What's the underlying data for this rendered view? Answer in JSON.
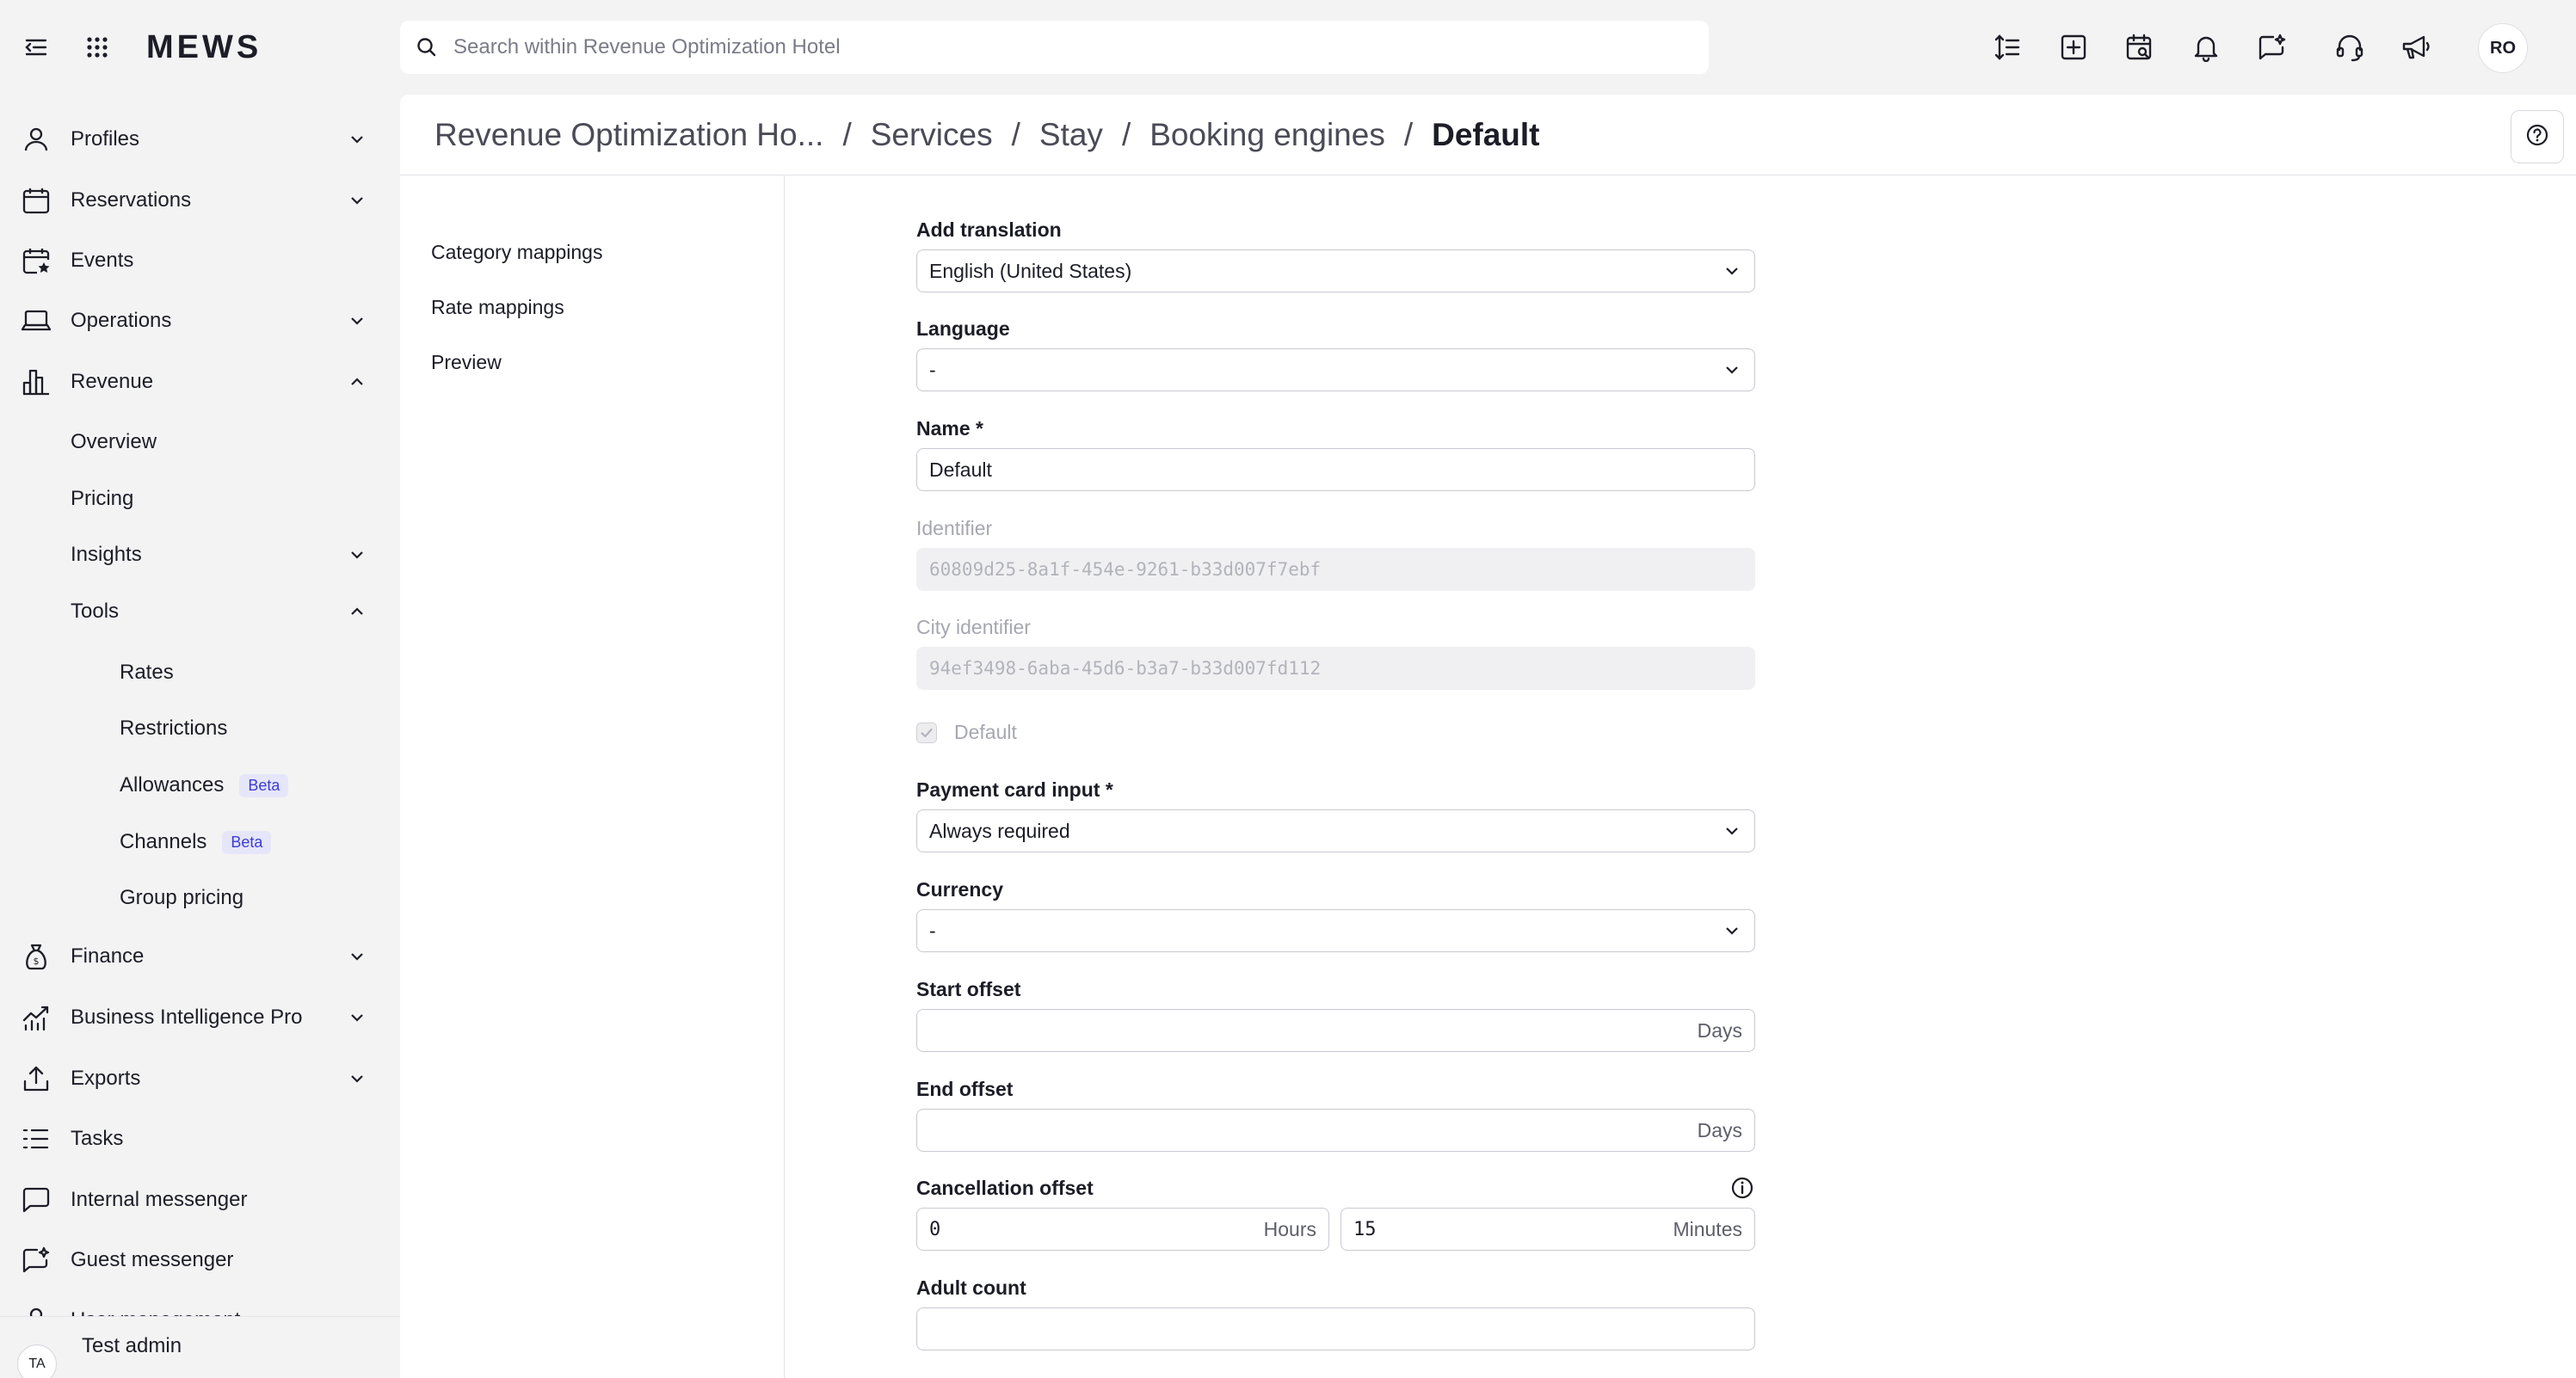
{
  "app": {
    "logo_text": "MEWS"
  },
  "search": {
    "placeholder": "Search within Revenue Optimization Hotel"
  },
  "topbar": {
    "icons": [
      "text-height-icon",
      "add-square-icon",
      "calendar-search-icon",
      "bell-icon",
      "chat-sparkle-icon",
      "headset-icon",
      "megaphone-icon"
    ],
    "user_initials": "RO"
  },
  "sidebar": {
    "items": [
      {
        "label": "Profiles",
        "icon": "user-icon",
        "expandable": true,
        "expanded": false
      },
      {
        "label": "Reservations",
        "icon": "calendar-icon",
        "expandable": true,
        "expanded": false
      },
      {
        "label": "Events",
        "icon": "calendar-star-icon",
        "expandable": false
      },
      {
        "label": "Operations",
        "icon": "laptop-icon",
        "expandable": true,
        "expanded": false
      },
      {
        "label": "Revenue",
        "icon": "bar-chart-icon",
        "expandable": true,
        "expanded": true
      },
      {
        "label": "Overview"
      },
      {
        "label": "Pricing"
      },
      {
        "label": "Insights",
        "expandable": true,
        "expanded": false
      },
      {
        "label": "Tools",
        "expandable": true,
        "expanded": true
      },
      {
        "label": "Rates"
      },
      {
        "label": "Restrictions"
      },
      {
        "label": "Allowances",
        "badge": "Beta"
      },
      {
        "label": "Channels",
        "badge": "Beta"
      },
      {
        "label": "Group pricing"
      },
      {
        "label": "Finance",
        "icon": "money-bag-icon",
        "expandable": true,
        "expanded": false
      },
      {
        "label": "Business Intelligence Pro",
        "icon": "trend-chart-icon",
        "expandable": true,
        "expanded": false
      },
      {
        "label": "Exports",
        "icon": "upload-icon",
        "expandable": true,
        "expanded": false
      },
      {
        "label": "Tasks",
        "icon": "task-list-icon",
        "expandable": false
      },
      {
        "label": "Internal messenger",
        "icon": "message-icon",
        "expandable": false
      },
      {
        "label": "Guest messenger",
        "icon": "guest-chat-icon",
        "expandable": false
      },
      {
        "label": "User management",
        "icon": "user-badge-icon",
        "expandable": true,
        "expanded": false
      }
    ],
    "user": {
      "initials": "TA",
      "name": "Test admin"
    }
  },
  "breadcrumb": {
    "items": [
      "Revenue Optimization Ho...",
      "Services",
      "Stay",
      "Booking engines"
    ],
    "current": "Default",
    "separator": "/"
  },
  "subnav": {
    "items": [
      "Category mappings",
      "Rate mappings",
      "Preview"
    ]
  },
  "form": {
    "add_translation": {
      "label": "Add translation",
      "value": "English (United States)"
    },
    "language": {
      "label": "Language",
      "value": "-"
    },
    "name": {
      "label": "Name *",
      "value": "Default"
    },
    "identifier": {
      "label": "Identifier",
      "value": "60809d25-8a1f-454e-9261-b33d007f7ebf"
    },
    "city_identifier": {
      "label": "City identifier",
      "value": "94ef3498-6aba-45d6-b3a7-b33d007fd112"
    },
    "default_checkbox": {
      "label": "Default",
      "checked": true
    },
    "payment_card_input": {
      "label": "Payment card input *",
      "value": "Always required"
    },
    "currency": {
      "label": "Currency",
      "value": "-"
    },
    "start_offset": {
      "label": "Start offset",
      "value": "",
      "unit": "Days"
    },
    "end_offset": {
      "label": "End offset",
      "value": "",
      "unit": "Days"
    },
    "cancellation_offset": {
      "label": "Cancellation offset",
      "hours_value": "0",
      "hours_unit": "Hours",
      "minutes_value": "15",
      "minutes_unit": "Minutes"
    },
    "adult_count": {
      "label": "Adult count",
      "value": ""
    }
  }
}
